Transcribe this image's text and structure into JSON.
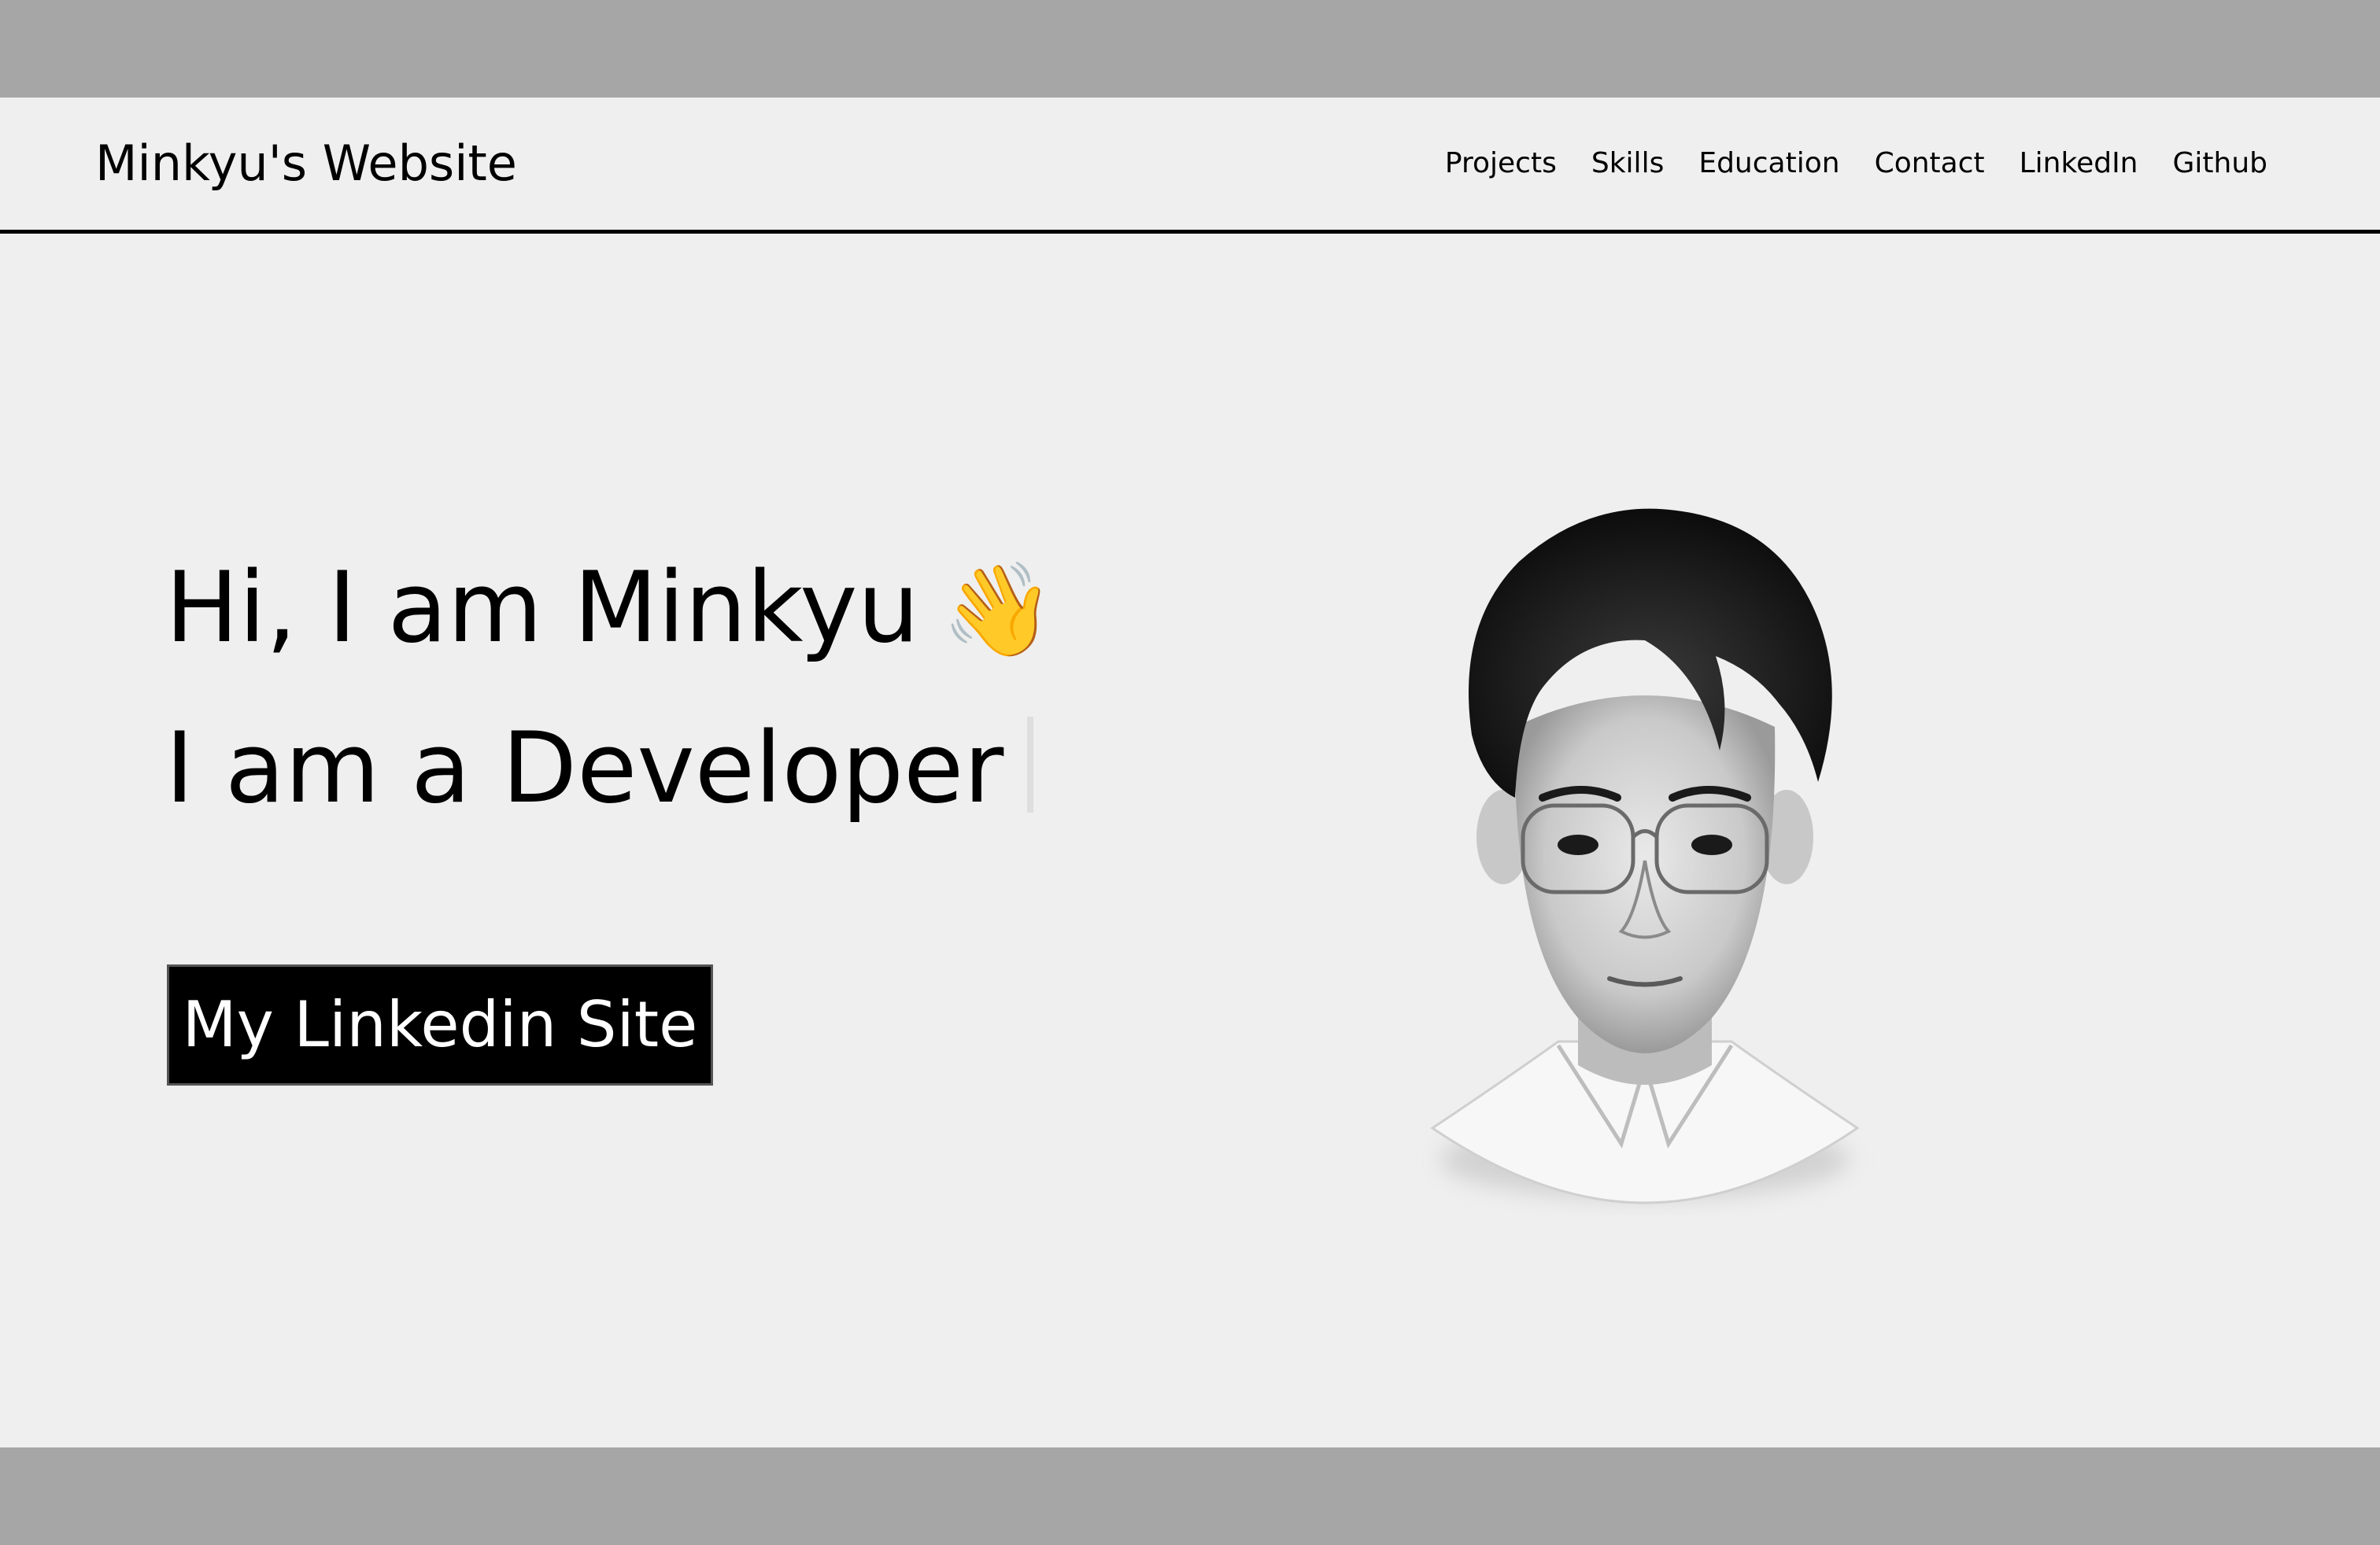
{
  "navbar": {
    "brand": "Minkyu's Website",
    "links": [
      {
        "label": "Projects"
      },
      {
        "label": "Skills"
      },
      {
        "label": "Education"
      },
      {
        "label": "Contact"
      },
      {
        "label": "LinkedIn"
      },
      {
        "label": "Github"
      }
    ]
  },
  "hero": {
    "greeting": "Hi, I am Minkyu",
    "wave_emoji": "👋",
    "role_line": "I am a Developer",
    "cta_label": "My Linkedin Site"
  },
  "colors": {
    "page_bg": "#efefef",
    "outer_band": "#a6a6a6",
    "button_bg": "#000000",
    "button_text": "#ffffff"
  },
  "icons": {
    "portrait": "profile-portrait-image"
  }
}
